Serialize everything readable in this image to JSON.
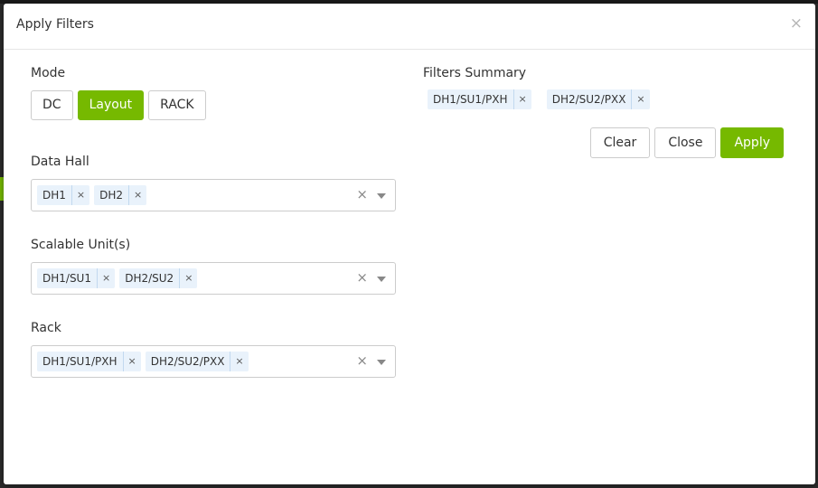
{
  "modal": {
    "title": "Apply Filters",
    "close_glyph": "×"
  },
  "mode": {
    "label": "Mode",
    "options": [
      "DC",
      "Layout",
      "RACK"
    ],
    "selected": "Layout"
  },
  "data_hall": {
    "label": "Data Hall",
    "chips": [
      "DH1",
      "DH2"
    ]
  },
  "scalable_units": {
    "label": "Scalable Unit(s)",
    "chips": [
      "DH1/SU1",
      "DH2/SU2"
    ]
  },
  "rack": {
    "label": "Rack",
    "chips": [
      "DH1/SU1/PXH",
      "DH2/SU2/PXX"
    ]
  },
  "summary": {
    "label": "Filters Summary",
    "chips": [
      "DH1/SU1/PXH",
      "DH2/SU2/PXX"
    ]
  },
  "actions": {
    "clear": "Clear",
    "close": "Close",
    "apply": "Apply"
  },
  "glyphs": {
    "chip_remove": "×",
    "select_clear": "×"
  },
  "colors": {
    "accent": "#76b900",
    "chip_bg": "#e9f2fb"
  }
}
